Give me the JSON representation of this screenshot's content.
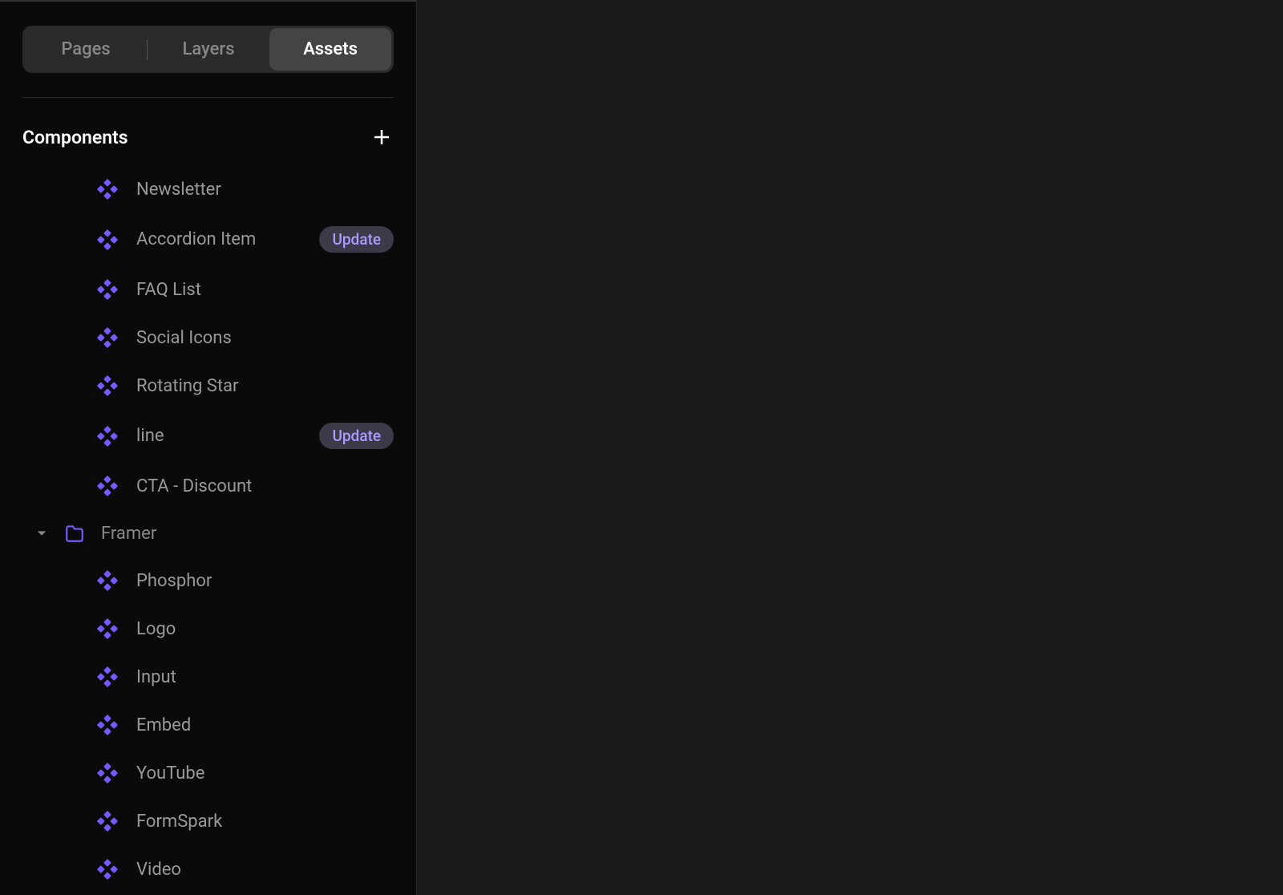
{
  "tabs": {
    "pages": "Pages",
    "layers": "Layers",
    "assets": "Assets"
  },
  "section": {
    "title": "Components"
  },
  "badge": {
    "update": "Update"
  },
  "components": {
    "root_items": [
      {
        "label": "Newsletter",
        "badge": null
      },
      {
        "label": "Accordion Item",
        "badge": "update"
      },
      {
        "label": "FAQ List",
        "badge": null
      },
      {
        "label": "Social Icons",
        "badge": null
      },
      {
        "label": "Rotating Star",
        "badge": null
      },
      {
        "label": "line",
        "badge": "update"
      },
      {
        "label": "CTA - Discount",
        "badge": null
      }
    ],
    "folder": {
      "name": "Framer",
      "items": [
        {
          "label": "Phosphor"
        },
        {
          "label": "Logo"
        },
        {
          "label": "Input"
        },
        {
          "label": "Embed"
        },
        {
          "label": "YouTube"
        },
        {
          "label": "FormSpark"
        },
        {
          "label": "Video"
        }
      ]
    }
  }
}
